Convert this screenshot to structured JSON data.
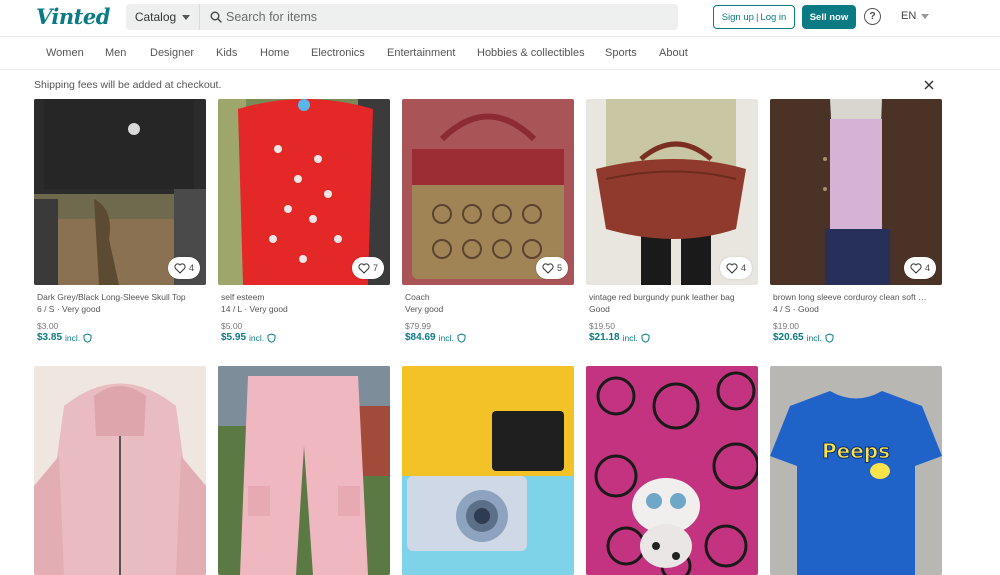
{
  "brand": {
    "logo_text": "Vinted",
    "accent": "#0a7b84"
  },
  "search": {
    "catalog_label": "Catalog",
    "placeholder": "Search for items"
  },
  "header": {
    "signup": "Sign up",
    "login": "Log in",
    "sep": "|",
    "sell": "Sell now",
    "help": "?",
    "lang": "EN"
  },
  "nav": [
    "Women",
    "Men",
    "Designer",
    "Kids",
    "Home",
    "Electronics",
    "Entertainment",
    "Hobbies & collectibles",
    "Sports",
    "About"
  ],
  "notice": {
    "text": "Shipping fees will be added at checkout."
  },
  "incl_label": "incl.",
  "items": [
    {
      "title": "Dark Grey/Black Long-Sleeve Skull Top",
      "details": "6 / S · Very good",
      "price": "$3.00",
      "price_incl": "$3.85",
      "favorites": "4"
    },
    {
      "title": "self esteem",
      "details": "14 / L · Very good",
      "price": "$5.00",
      "price_incl": "$5.95",
      "favorites": "7"
    },
    {
      "title": "Coach",
      "details": "Very good",
      "price": "$79.99",
      "price_incl": "$84.69",
      "favorites": "5"
    },
    {
      "title": "vintage red burgundy punk leather bag",
      "details": "Good",
      "price": "$19.50",
      "price_incl": "$21.18",
      "favorites": "4"
    },
    {
      "title": "brown long sleeve corduroy clean soft …",
      "details": "4 / S · Good",
      "price": "$19.00",
      "price_incl": "$20.65",
      "favorites": "4"
    }
  ],
  "second_row_photos": [
    "pink-hoodie-photo",
    "pink-cargo-pants-photo",
    "blue-camera-photo",
    "toy-dog-on-lace-photo",
    "peeps-tshirt-photo"
  ],
  "photo_text": {
    "peeps": "Peeps"
  }
}
